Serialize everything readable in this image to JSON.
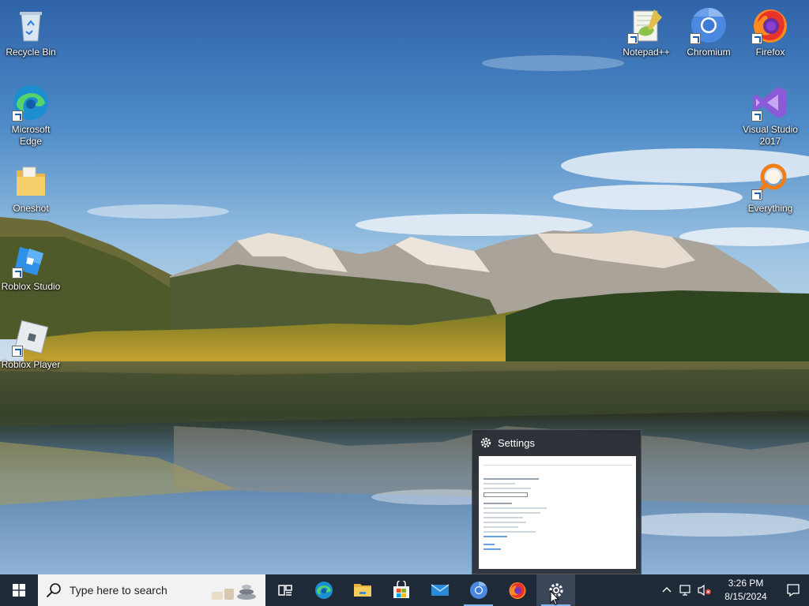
{
  "desktop": {
    "icons": [
      {
        "label": "Recycle Bin",
        "icon": "recycle-bin-icon"
      },
      {
        "label": "Microsoft Edge",
        "icon": "edge-icon"
      },
      {
        "label": "Oneshot",
        "icon": "folder-icon"
      },
      {
        "label": "Roblox Studio",
        "icon": "roblox-studio-icon"
      },
      {
        "label": "Roblox Player",
        "icon": "roblox-player-icon"
      },
      {
        "label": "Notepad++",
        "icon": "notepad-plus-plus-icon"
      },
      {
        "label": "Chromium",
        "icon": "chromium-icon"
      },
      {
        "label": "Firefox",
        "icon": "firefox-icon"
      },
      {
        "label": "Visual Studio 2017",
        "icon": "visual-studio-icon"
      },
      {
        "label": "Everything",
        "icon": "everything-search-icon"
      }
    ]
  },
  "thumbnail": {
    "title": "Settings",
    "icon": "gear-icon"
  },
  "taskbar": {
    "search_placeholder": "Type here to search",
    "pinned": [
      {
        "name": "task-view-icon"
      },
      {
        "name": "edge-icon"
      },
      {
        "name": "file-explorer-icon"
      },
      {
        "name": "microsoft-store-icon"
      },
      {
        "name": "mail-icon"
      },
      {
        "name": "chromium-icon"
      },
      {
        "name": "firefox-icon"
      },
      {
        "name": "settings-gear-icon"
      }
    ],
    "tray": {
      "time": "3:26 PM",
      "date": "8/15/2024"
    }
  },
  "colors": {
    "taskbar": "#1f2a38",
    "search_box": "#f2f2f2",
    "active_indicator": "#86b6ef"
  }
}
